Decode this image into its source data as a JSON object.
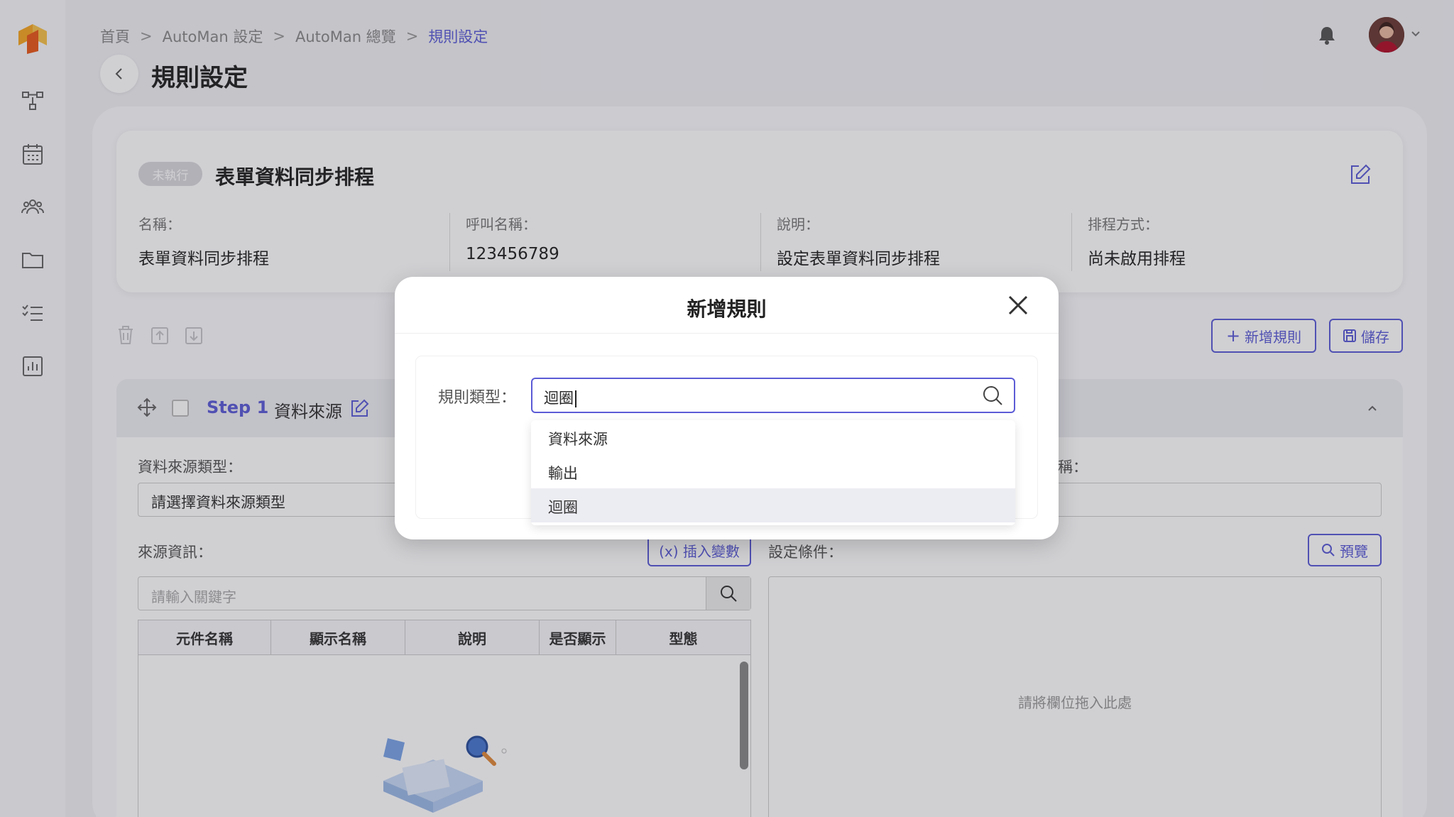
{
  "header": {
    "breadcrumb": [
      "首頁",
      "AutoMan 設定",
      "AutoMan 總覽",
      "規則設定"
    ],
    "page_title": "規則設定"
  },
  "colors": {
    "accent": "#5b5bd6",
    "badge": "#d8d8dc",
    "logo_orange": "#f5a623"
  },
  "card": {
    "status": "未執行",
    "title": "表單資料同步排程",
    "fields": [
      {
        "label": "名稱：",
        "value": "表單資料同步排程"
      },
      {
        "label": "呼叫名稱：",
        "value": "123456789"
      },
      {
        "label": "說明：",
        "value": "設定表單資料同步排程"
      },
      {
        "label": "排程方式：",
        "value": "尚未啟用排程"
      }
    ]
  },
  "toolbar": {
    "add_rule": "新增規則",
    "save": "儲存"
  },
  "step": {
    "number": "Step 1",
    "name": "資料來源",
    "source_type_label": "資料來源類型：",
    "source_type_placeholder": "請選擇資料來源類型",
    "right_label_fragment": "稱：",
    "source_info_label": "來源資訊：",
    "insert_var": "(x) 插入變數",
    "condition_label": "設定條件：",
    "preview": "預覽",
    "keyword_placeholder": "請輸入關鍵字",
    "columns": [
      "元件名稱",
      "顯示名稱",
      "說明",
      "是否顯示",
      "型態"
    ],
    "drop_hint": "請將欄位拖入此處"
  },
  "modal": {
    "title": "新增規則",
    "rule_type_label": "規則類型：",
    "rule_type_value": "迴圈",
    "options": [
      "資料來源",
      "輸出",
      "迴圈"
    ],
    "highlighted_option": "迴圈"
  }
}
